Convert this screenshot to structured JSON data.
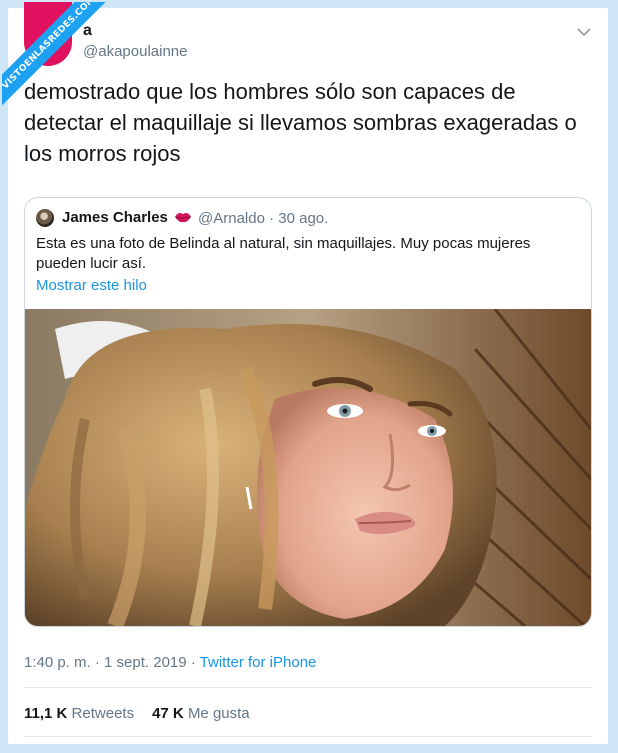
{
  "watermark": "VISTOENLASREDES.COM",
  "tweet": {
    "display_name": "a",
    "handle": "@akapoulainne",
    "text": "demostrado que los hombres sólo son capaces de detectar el maquillaje si llevamos sombras exageradas o los morros rojos",
    "timestamp": "1:40 p. m. · 1 sept. 2019 · ",
    "source": "Twitter for iPhone",
    "retweets_count": "11,1 K",
    "retweets_label": "Retweets",
    "likes_count": "47 K",
    "likes_label": "Me gusta"
  },
  "quoted_tweet": {
    "display_name": "James Charles",
    "handle": "@Arnaldo · 30 ago.",
    "text": "Esta es una foto de Belinda al natural, sin maquillajes. Muy pocas mujeres pueden lucir así.",
    "show_thread": "Mostrar este hilo",
    "icons": [
      "lips-emoji",
      "avatar"
    ]
  },
  "icons": {
    "menu": "chevron-down-icon"
  },
  "colors": {
    "link": "#1b95e0",
    "secondary_text": "#657786",
    "background_frame": "#cfe6f7",
    "avatar_pink": "#e0115f"
  }
}
